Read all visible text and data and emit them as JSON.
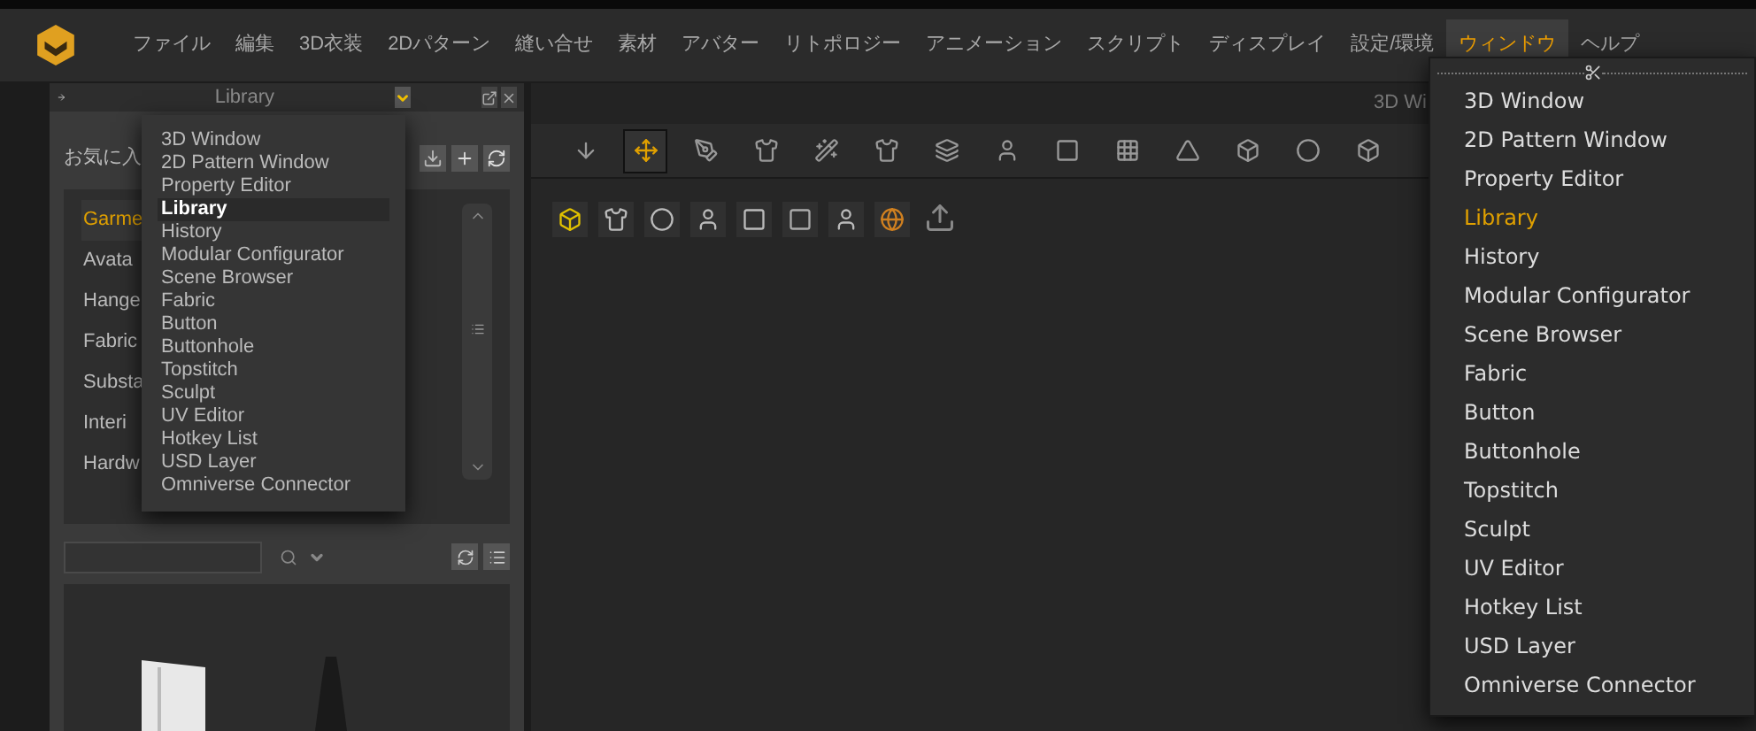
{
  "menu_bar": {
    "items": [
      {
        "label": "ファイル",
        "selected": false
      },
      {
        "label": "編集",
        "selected": false
      },
      {
        "label": "3D衣装",
        "selected": false
      },
      {
        "label": "2Dパターン",
        "selected": false
      },
      {
        "label": "縫い合せ",
        "selected": false
      },
      {
        "label": "素材",
        "selected": false
      },
      {
        "label": "アバター",
        "selected": false
      },
      {
        "label": "リトポロジー",
        "selected": false
      },
      {
        "label": "アニメーション",
        "selected": false
      },
      {
        "label": "スクリプト",
        "selected": false
      },
      {
        "label": "ディスプレイ",
        "selected": false
      },
      {
        "label": "設定/環境",
        "selected": false
      },
      {
        "label": "ウィンドウ",
        "selected": true
      },
      {
        "label": "ヘルプ",
        "selected": false
      }
    ]
  },
  "library_panel": {
    "title": "Library",
    "favorites_label": "お気に入",
    "categories": [
      {
        "label": "Garme",
        "selected": true
      },
      {
        "label": "Avata",
        "selected": false
      },
      {
        "label": "Hange",
        "selected": false
      },
      {
        "label": "Fabric",
        "selected": false
      },
      {
        "label": "Substa",
        "selected": false
      },
      {
        "label": "Interi",
        "selected": false
      },
      {
        "label": "Hardw",
        "selected": false
      }
    ]
  },
  "panel_menu": {
    "items": [
      {
        "label": "3D Window",
        "selected": false
      },
      {
        "label": "2D Pattern Window",
        "selected": false
      },
      {
        "label": "Property Editor",
        "selected": false
      },
      {
        "label": "Library",
        "selected": true
      },
      {
        "label": "History",
        "selected": false
      },
      {
        "label": "Modular Configurator",
        "selected": false
      },
      {
        "label": "Scene Browser",
        "selected": false
      },
      {
        "label": "Fabric",
        "selected": false
      },
      {
        "label": "Button",
        "selected": false
      },
      {
        "label": "Buttonhole",
        "selected": false
      },
      {
        "label": "Topstitch",
        "selected": false
      },
      {
        "label": "Sculpt",
        "selected": false
      },
      {
        "label": "UV Editor",
        "selected": false
      },
      {
        "label": "Hotkey List",
        "selected": false
      },
      {
        "label": "USD Layer",
        "selected": false
      },
      {
        "label": "Omniverse Connector",
        "selected": false
      }
    ]
  },
  "viewport": {
    "title": "3D Wi"
  },
  "window_menu": {
    "items": [
      {
        "label": "3D Window",
        "selected": false
      },
      {
        "label": "2D Pattern Window",
        "selected": false
      },
      {
        "label": "Property Editor",
        "selected": false
      },
      {
        "label": "Library",
        "selected": true
      },
      {
        "label": "History",
        "selected": false
      },
      {
        "label": "Modular Configurator",
        "selected": false
      },
      {
        "label": "Scene Browser",
        "selected": false
      },
      {
        "label": "Fabric",
        "selected": false
      },
      {
        "label": "Button",
        "selected": false
      },
      {
        "label": "Buttonhole",
        "selected": false
      },
      {
        "label": "Topstitch",
        "selected": false
      },
      {
        "label": "Sculpt",
        "selected": false
      },
      {
        "label": "UV Editor",
        "selected": false
      },
      {
        "label": "Hotkey List",
        "selected": false
      },
      {
        "label": "USD Layer",
        "selected": false
      },
      {
        "label": "Omniverse Connector",
        "selected": false
      }
    ]
  }
}
